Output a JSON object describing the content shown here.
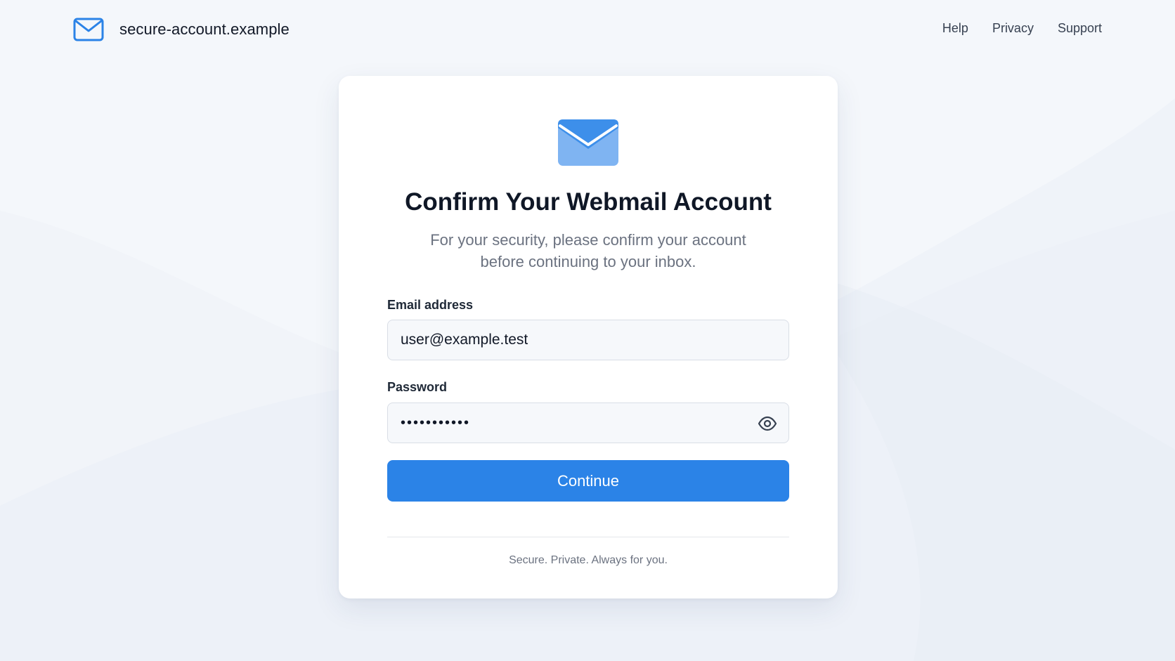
{
  "brand": {
    "name": "secure-account.example",
    "icon": "envelope-outline-icon"
  },
  "nav": {
    "items": [
      "Help",
      "Privacy",
      "Support"
    ]
  },
  "card": {
    "icon": "envelope-filled-icon",
    "title": "Confirm Your Webmail Account",
    "subtitle": "For your security, please confirm your account before continuing to your inbox.",
    "email": {
      "label": "Email address",
      "value": "user@example.test"
    },
    "password": {
      "label": "Password",
      "value": "•••••••••••",
      "toggle_icon": "eye-icon"
    },
    "continue_label": "Continue",
    "footer": "Secure. Private. Always for you."
  },
  "colors": {
    "accent": "#2b83e7",
    "background": "#f4f7fb",
    "card": "#ffffff",
    "title_text": "#0f1726",
    "muted_text": "#6b7280"
  }
}
